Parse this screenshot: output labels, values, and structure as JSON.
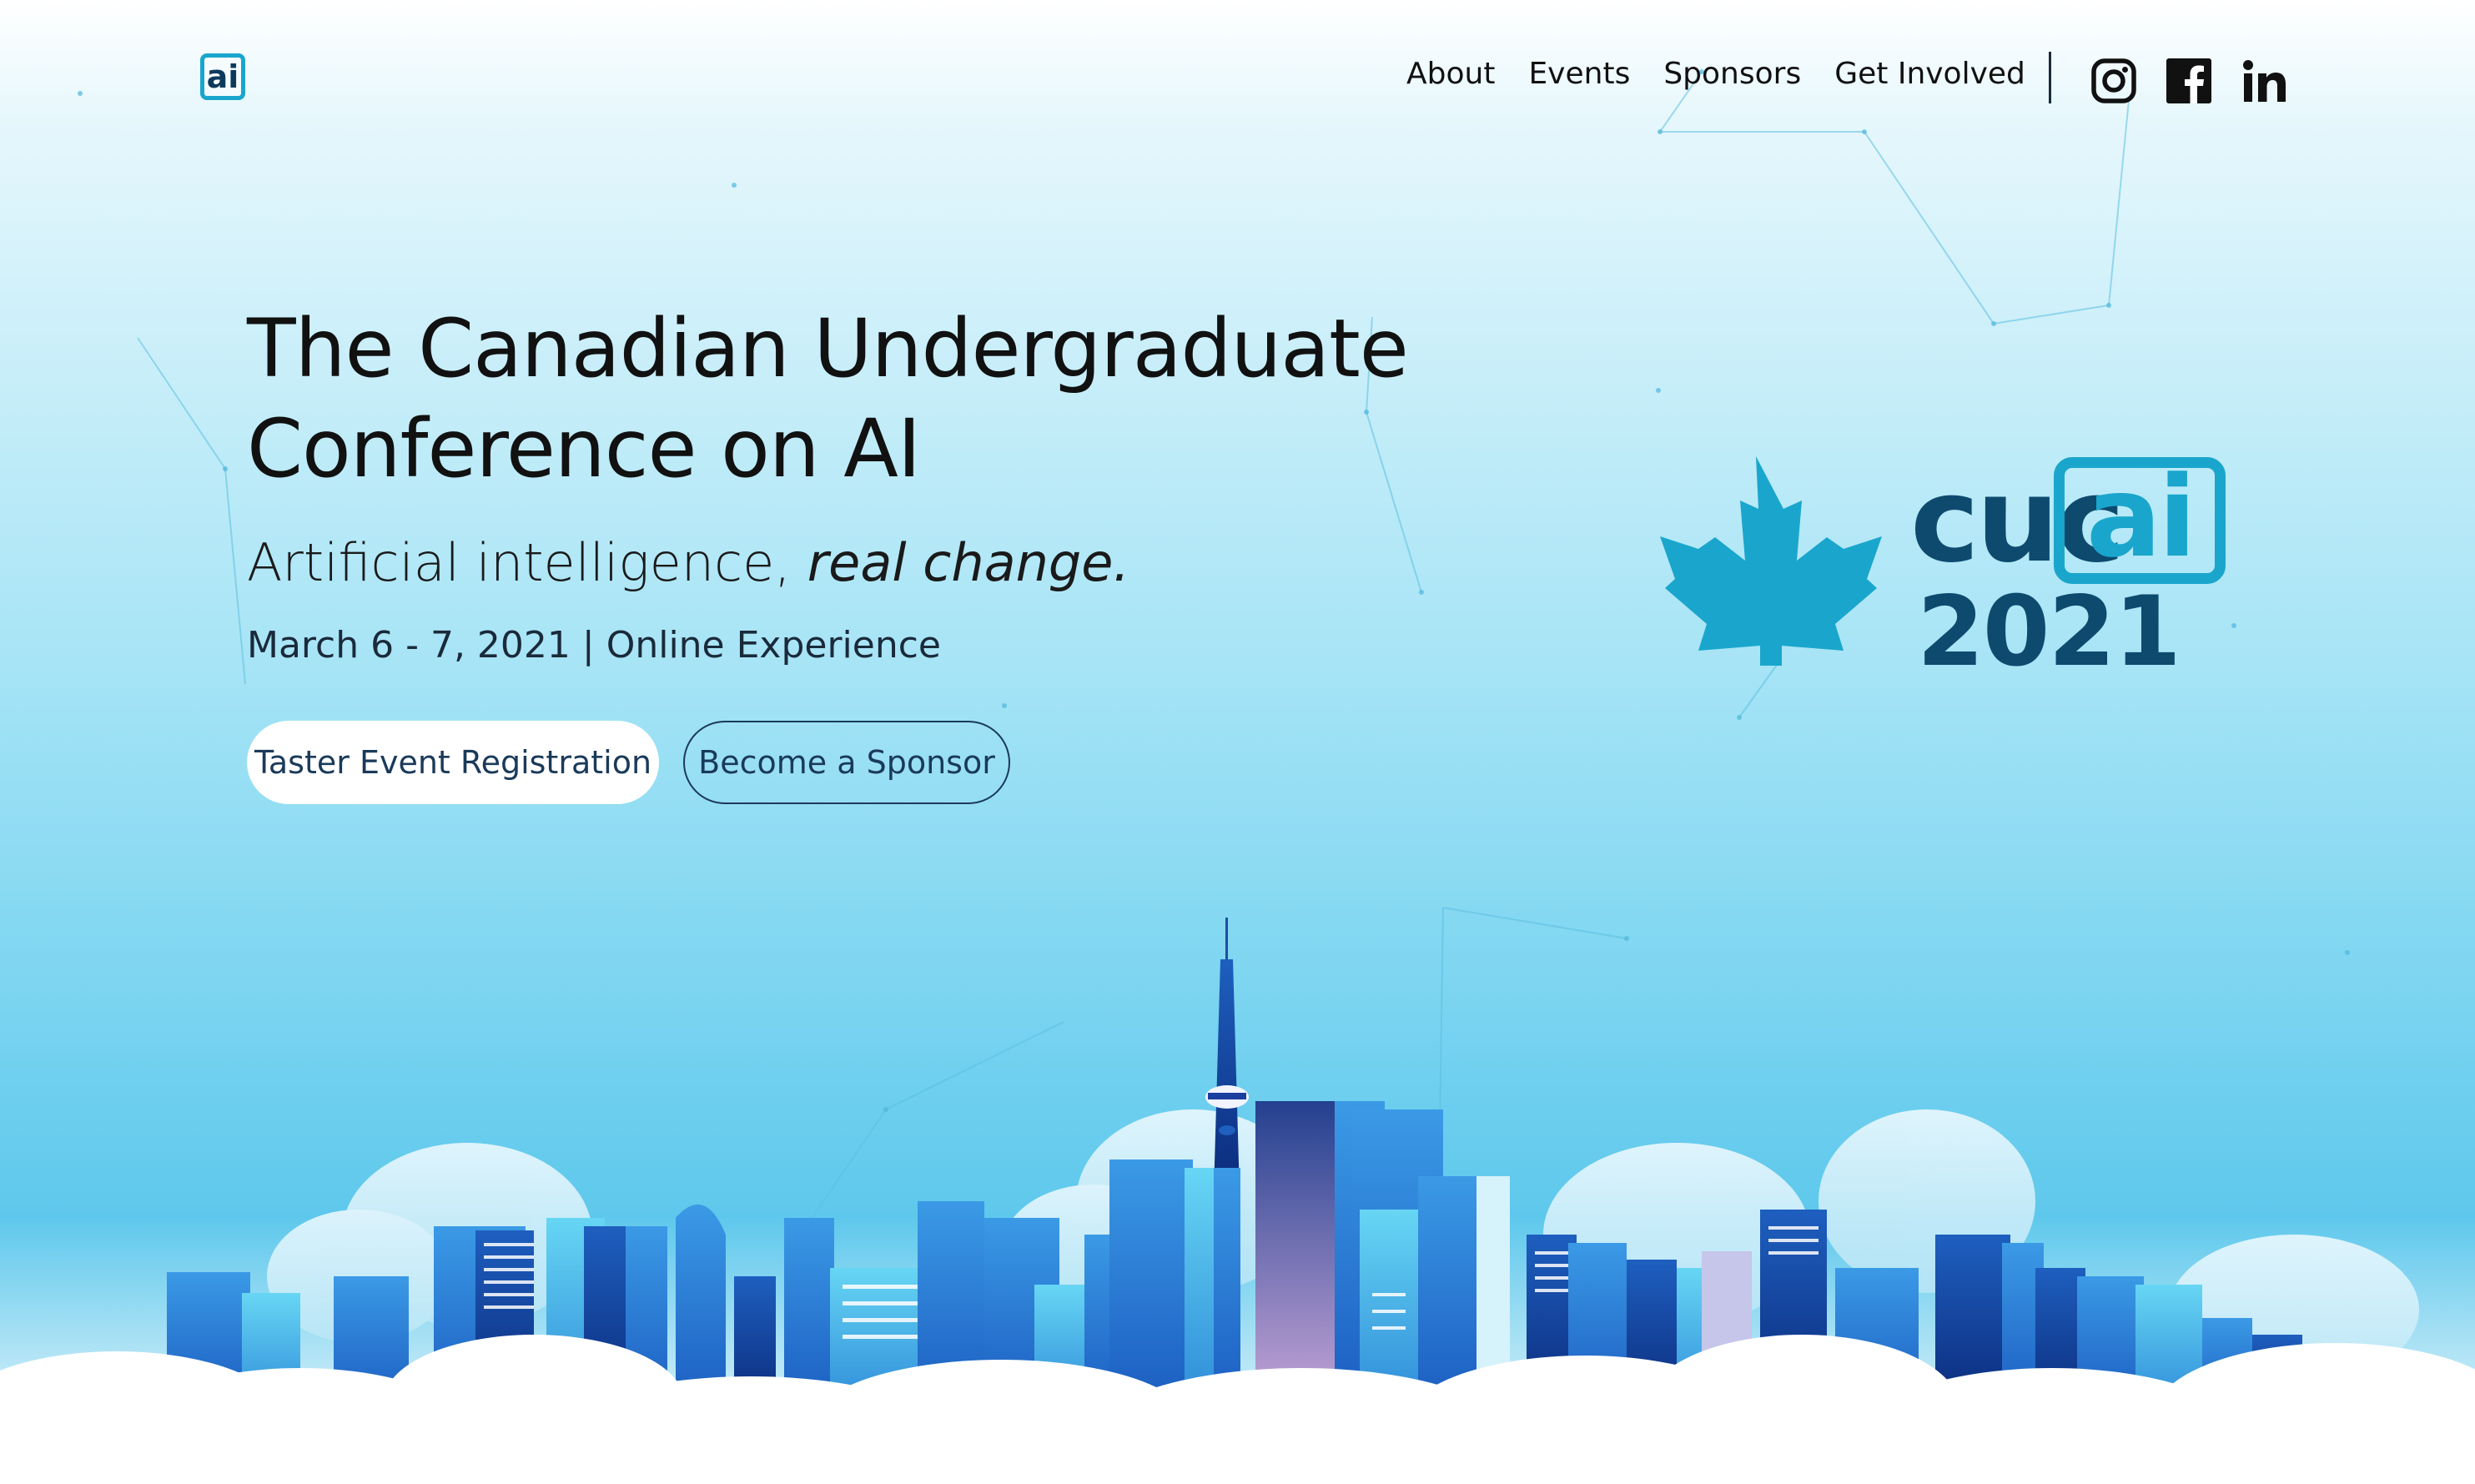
{
  "header": {
    "logo_text": "ai",
    "nav": [
      {
        "label": "About"
      },
      {
        "label": "Events"
      },
      {
        "label": "Sponsors"
      },
      {
        "label": "Get Involved"
      }
    ],
    "social": [
      {
        "icon": "instagram-icon"
      },
      {
        "icon": "facebook-icon"
      },
      {
        "icon": "linkedin-icon"
      }
    ]
  },
  "hero": {
    "title_line1": "The Canadian Undergraduate",
    "title_line2": "Conference on AI",
    "tagline_plain": "Artificial intelligence,",
    "tagline_italic": "real change.",
    "date_line": "March 6 - 7, 2021 | Online Experience",
    "primary_button": "Taster Event Registration",
    "secondary_button": "Become a Sponsor"
  },
  "brand_logo": {
    "prefix": "cuc",
    "boxed": "ai",
    "year": "2021"
  },
  "colors": {
    "accent": "#1aa6cc",
    "navy": "#0d4a6e",
    "text": "#111111"
  }
}
